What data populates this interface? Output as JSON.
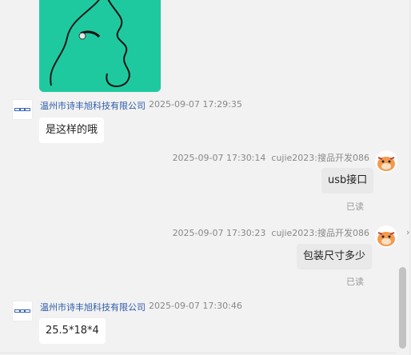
{
  "messages": [
    {
      "sender": "温州市诗丰旭科技有限公司",
      "time": "2025-09-07 17:29:35",
      "text": "是这样的哦"
    },
    {
      "time": "2025-09-07 17:30:14",
      "sender": "cujie2023:搜品开发086",
      "text": "usb接口",
      "status": "已读"
    },
    {
      "time": "2025-09-07 17:30:23",
      "sender": "cujie2023:搜品开发086",
      "text": "包装尺寸多少",
      "status": "已读"
    },
    {
      "sender": "温州市诗丰旭科技有限公司",
      "time": "2025-09-07 17:30:46",
      "text": "25.5*18*4"
    }
  ],
  "icons": {
    "company_avatar": "company-logo-icon",
    "user_avatar": "cartoon-avatar-icon",
    "edge": "chevron-right-icon"
  },
  "colors": {
    "background": "#f2f2f2",
    "sender_name": "#2d5aa8",
    "image_bg": "#1fc9a0",
    "avatar_orange": "#f39a4e"
  }
}
